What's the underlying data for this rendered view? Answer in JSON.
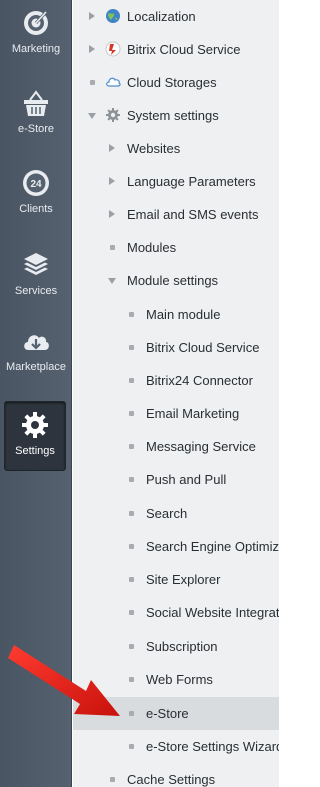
{
  "sidebar": {
    "items": [
      {
        "label": "Marketing",
        "icon": "target-icon"
      },
      {
        "label": "e-Store",
        "icon": "basket-icon"
      },
      {
        "label": "Clients",
        "icon": "clients-24-icon"
      },
      {
        "label": "Services",
        "icon": "layers-icon"
      },
      {
        "label": "Marketplace",
        "icon": "cloud-download-icon"
      },
      {
        "label": "Settings",
        "icon": "gear-icon",
        "active": true
      }
    ]
  },
  "tree": {
    "items": [
      {
        "label": "Localization",
        "marker": "arrow-right",
        "icon": "globe-icon"
      },
      {
        "label": "Bitrix Cloud Service",
        "marker": "arrow-right",
        "icon": "cloud-service-icon"
      },
      {
        "label": "Cloud Storages",
        "marker": "dot",
        "icon": "cloud-storage-icon"
      },
      {
        "label": "System settings",
        "marker": "arrow-down",
        "icon": "settings-gear-icon"
      },
      {
        "label": "Websites",
        "marker": "arrow-right"
      },
      {
        "label": "Language Parameters",
        "marker": "arrow-right"
      },
      {
        "label": "Email and SMS events",
        "marker": "arrow-right"
      },
      {
        "label": "Modules",
        "marker": "dot"
      },
      {
        "label": "Module settings",
        "marker": "arrow-down"
      },
      {
        "label": "Main module",
        "marker": "dot"
      },
      {
        "label": "Bitrix Cloud Service",
        "marker": "dot"
      },
      {
        "label": "Bitrix24 Connector",
        "marker": "dot"
      },
      {
        "label": "Email Marketing",
        "marker": "dot"
      },
      {
        "label": "Messaging Service",
        "marker": "dot"
      },
      {
        "label": "Push and Pull",
        "marker": "dot"
      },
      {
        "label": "Search",
        "marker": "dot"
      },
      {
        "label": "Search Engine Optimiza",
        "marker": "dot"
      },
      {
        "label": "Site Explorer",
        "marker": "dot"
      },
      {
        "label": "Social Website Integratio",
        "marker": "dot"
      },
      {
        "label": "Subscription",
        "marker": "dot"
      },
      {
        "label": "Web Forms",
        "marker": "dot"
      },
      {
        "label": "e-Store",
        "marker": "dot",
        "selected": true
      },
      {
        "label": "e-Store Settings Wizard",
        "marker": "dot"
      },
      {
        "label": "Cache Settings",
        "marker": "dot"
      }
    ]
  },
  "colors": {
    "sidebar_bg": "#4f5a67",
    "tree_bg": "#eef0f1",
    "selected_row": "#d9dcde",
    "annotation_arrow": "#e01b1b"
  }
}
